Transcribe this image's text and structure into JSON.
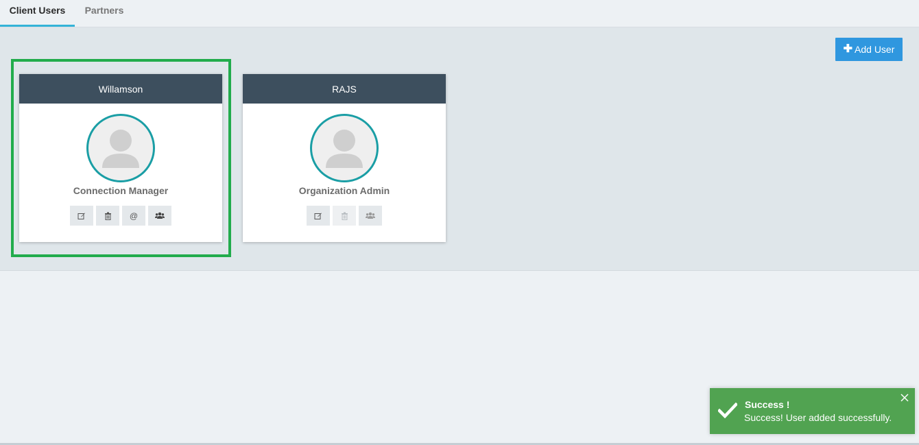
{
  "tabs": [
    {
      "label": "Client Users",
      "active": true
    },
    {
      "label": "Partners",
      "active": false
    }
  ],
  "toolbar": {
    "add_user_label": "Add User",
    "add_icon": "plus-icon"
  },
  "users": [
    {
      "name": "Willamson",
      "role": "Connection Manager",
      "actions": [
        "edit-icon",
        "trash-icon",
        "at-icon",
        "group-icon"
      ],
      "selected": true
    },
    {
      "name": "RAJS",
      "role": "Organization Admin",
      "actions": [
        "edit-icon",
        "trash-icon",
        "group-icon"
      ],
      "selected": false
    }
  ],
  "toast": {
    "title": "Success !",
    "message": "Success! User added successfully.",
    "icon": "check-icon",
    "color": "#51a351"
  },
  "colors": {
    "accent": "#34b3d8",
    "button": "#2f97df",
    "card_header": "#3d4f5e",
    "avatar_ring": "#1a9ea5",
    "selection": "#22ac4c"
  }
}
